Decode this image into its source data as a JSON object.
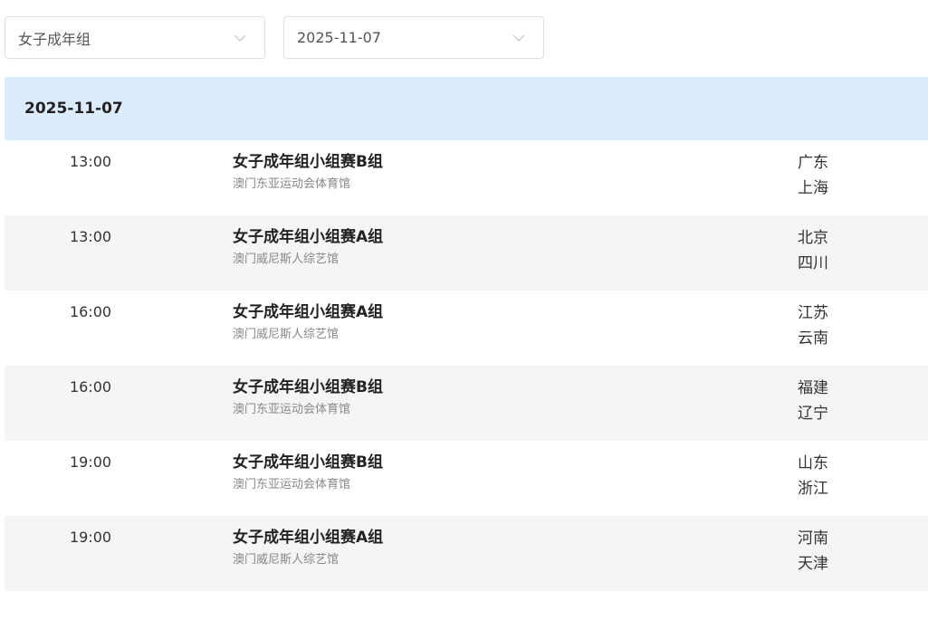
{
  "filters": {
    "group": {
      "value": "女子成年组",
      "icon": "chevron-down-icon"
    },
    "date": {
      "value": "2025-11-07",
      "icon": "chevron-down-icon"
    }
  },
  "schedule": {
    "date": "2025-11-07",
    "matches": [
      {
        "time": "13:00",
        "title": "女子成年组小组赛B组",
        "venue": "澳门东亚运动会体育馆",
        "team1": "广东",
        "team2": "上海"
      },
      {
        "time": "13:00",
        "title": "女子成年组小组赛A组",
        "venue": "澳门威尼斯人综艺馆",
        "team1": "北京",
        "team2": "四川"
      },
      {
        "time": "16:00",
        "title": "女子成年组小组赛A组",
        "venue": "澳门威尼斯人综艺馆",
        "team1": "江苏",
        "team2": "云南"
      },
      {
        "time": "16:00",
        "title": "女子成年组小组赛B组",
        "venue": "澳门东亚运动会体育馆",
        "team1": "福建",
        "team2": "辽宁"
      },
      {
        "time": "19:00",
        "title": "女子成年组小组赛B组",
        "venue": "澳门东亚运动会体育馆",
        "team1": "山东",
        "team2": "浙江"
      },
      {
        "time": "19:00",
        "title": "女子成年组小组赛A组",
        "venue": "澳门威尼斯人综艺馆",
        "team1": "河南",
        "team2": "天津"
      }
    ]
  },
  "colors": {
    "header_bg": "#dcecfd",
    "row_alt_bg": "#f5f5f5",
    "border": "#dcdfe6"
  }
}
